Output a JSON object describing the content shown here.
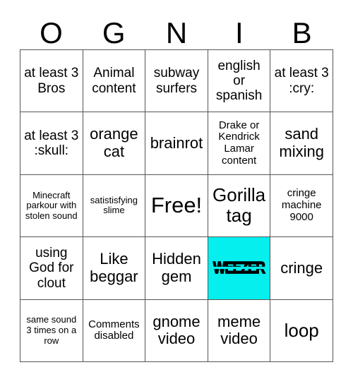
{
  "card": {
    "title_letters": [
      "O",
      "G",
      "N",
      "I",
      "B"
    ],
    "marked_color": "#05efef",
    "grid_line_color": "#555555",
    "background_color": "#ffffff",
    "rows": [
      [
        {
          "text": "at least 3 Bros",
          "size": "md",
          "marked": false
        },
        {
          "text": "Animal content",
          "size": "md",
          "marked": false
        },
        {
          "text": "subway surfers",
          "size": "md",
          "marked": false
        },
        {
          "text": "english or spanish",
          "size": "md",
          "marked": false
        },
        {
          "text": "at least 3 :cry:",
          "size": "md",
          "marked": false
        }
      ],
      [
        {
          "text": "at least 3 :skull:",
          "size": "md",
          "marked": false
        },
        {
          "text": "orange cat",
          "size": "lg",
          "marked": false
        },
        {
          "text": "brainrot",
          "size": "lg",
          "marked": false
        },
        {
          "text": "Drake or Kendrick Lamar content",
          "size": "sm",
          "marked": false
        },
        {
          "text": "sand mixing",
          "size": "lg",
          "marked": false
        }
      ],
      [
        {
          "text": "Minecraft parkour with stolen sound",
          "size": "xs",
          "marked": false
        },
        {
          "text": "satistisfying slime",
          "size": "xs",
          "marked": false
        },
        {
          "text": "Free!",
          "size": "xxl",
          "marked": false
        },
        {
          "text": "Gorilla tag",
          "size": "xl",
          "marked": false
        },
        {
          "text": "cringe machine 9000",
          "size": "sm",
          "marked": false
        }
      ],
      [
        {
          "text": "using God for clout",
          "size": "md",
          "marked": false
        },
        {
          "text": "Like beggar",
          "size": "lg",
          "marked": false
        },
        {
          "text": "Hidden gem",
          "size": "lg",
          "marked": false
        },
        {
          "text": "WEEZER",
          "size": "md",
          "marked": true,
          "style": "weezer-logo"
        },
        {
          "text": "cringe",
          "size": "lg",
          "marked": false
        }
      ],
      [
        {
          "text": "same sound 3 times on a row",
          "size": "xs",
          "marked": false
        },
        {
          "text": "Comments disabled",
          "size": "sm",
          "marked": false
        },
        {
          "text": "gnome video",
          "size": "lg",
          "marked": false
        },
        {
          "text": "meme video",
          "size": "lg",
          "marked": false
        },
        {
          "text": "loop",
          "size": "xl",
          "marked": false
        }
      ]
    ]
  }
}
